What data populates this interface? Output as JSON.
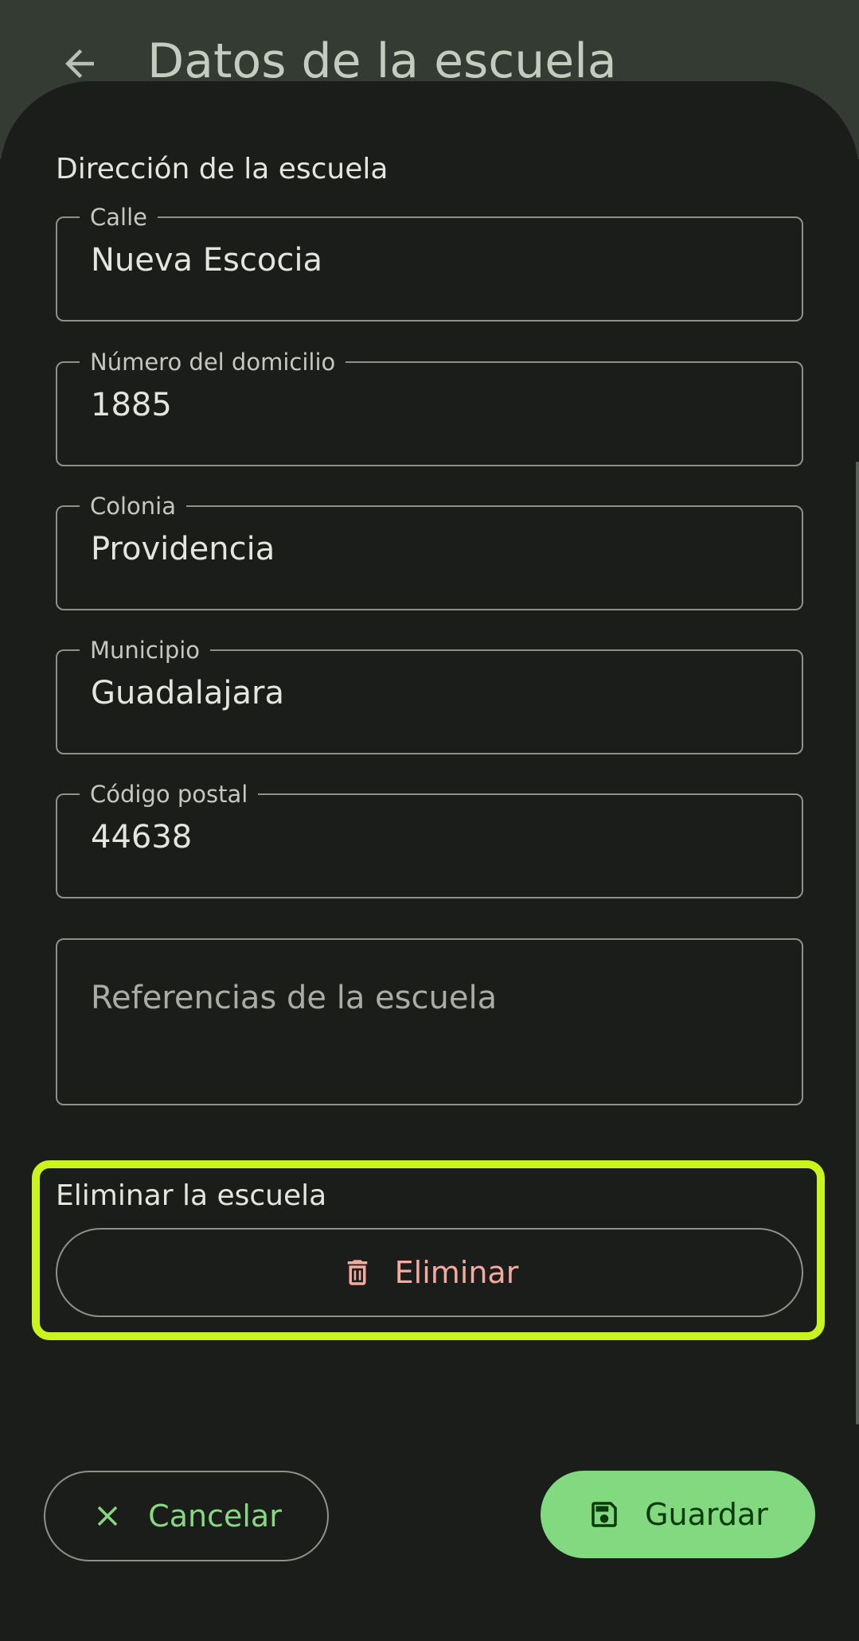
{
  "header": {
    "title": "Datos de la escuela",
    "back_icon": "arrow-back-icon"
  },
  "address_section": {
    "title": "Dirección de la escuela",
    "fields": [
      {
        "label": "Calle",
        "value": "Nueva Escocia"
      },
      {
        "label": "Número del domicilio",
        "value": "1885"
      },
      {
        "label": "Colonia",
        "value": "Providencia"
      },
      {
        "label": "Municipio",
        "value": "Guadalajara"
      },
      {
        "label": "Código postal",
        "value": "44638"
      }
    ],
    "references": {
      "placeholder": "Referencias de la escuela",
      "value": ""
    }
  },
  "delete_section": {
    "title": "Eliminar la escuela",
    "button_label": "Eliminar",
    "button_icon": "trash-icon"
  },
  "footer": {
    "cancel_label": "Cancelar",
    "cancel_icon": "close-icon",
    "save_label": "Guardar",
    "save_icon": "save-icon"
  },
  "colors": {
    "topbar": "#343b33",
    "background": "#1b1d1b",
    "accent_green": "#82d97f",
    "delete_text": "#f3aba1",
    "highlight": "#cbf41f"
  }
}
